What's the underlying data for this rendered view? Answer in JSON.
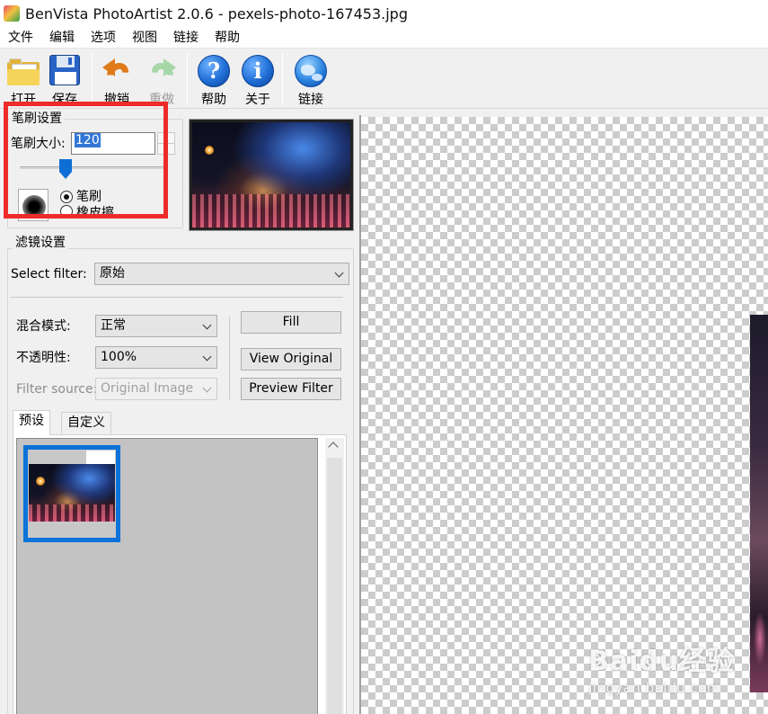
{
  "window": {
    "title": "BenVista PhotoArtist 2.0.6 - pexels-photo-167453.jpg"
  },
  "menu": [
    "文件",
    "编辑",
    "选项",
    "视图",
    "链接",
    "帮助"
  ],
  "toolbar": {
    "open": "打开",
    "save": "保存",
    "undo": "撤销",
    "redo": "重做",
    "help": "帮助",
    "about": "关于",
    "link": "链接"
  },
  "brush": {
    "group_title": "笔刷设置",
    "size_label": "笔刷大小:",
    "size_value": "120",
    "slider_fraction": 0.32,
    "mode_brush": "笔刷",
    "mode_eraser": "橡皮擦",
    "selected_mode": "笔刷"
  },
  "filter": {
    "group_title": "滤镜设置",
    "select_label": "Select filter:",
    "select_value": "原始",
    "blend_label": "混合模式:",
    "blend_value": "正常",
    "opacity_label": "不透明性:",
    "opacity_value": "100%",
    "source_label": "Filter source:",
    "source_value": "Original Image",
    "fill_button": "Fill",
    "view_original_button": "View Original",
    "preview_filter_button": "Preview Filter"
  },
  "tabs": {
    "presets": "预设",
    "custom": "自定义",
    "active": "预设"
  },
  "watermark": {
    "main": "Baidu经验",
    "sub": "jingyan.baidu.com"
  },
  "colors": {
    "highlight_box": "#ee2a2a",
    "selection_blue": "#0b73d9",
    "slider_blue": "#0d6fd6"
  }
}
